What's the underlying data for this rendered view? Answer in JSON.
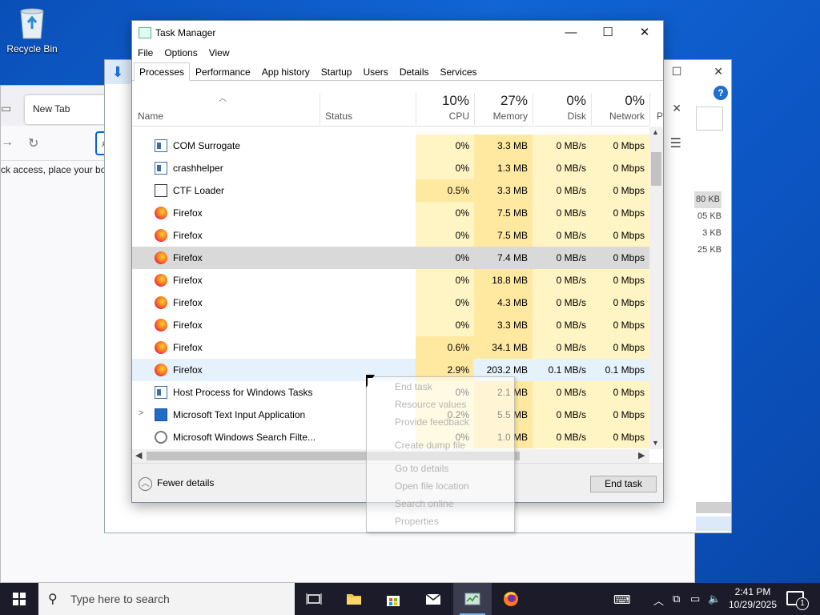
{
  "desktop": {
    "recycle_bin_label": "Recycle Bin"
  },
  "browser": {
    "tab_title": "New Tab",
    "bookmarks_hint": "ck access, place your bookmarks"
  },
  "explorer_bg": {
    "sizes": [
      "80 KB",
      "05 KB",
      "3 KB",
      "25 KB"
    ]
  },
  "task_manager": {
    "title": "Task Manager",
    "menu": [
      "File",
      "Options",
      "View"
    ],
    "tabs": [
      "Processes",
      "Performance",
      "App history",
      "Startup",
      "Users",
      "Details",
      "Services"
    ],
    "active_tab": "Processes",
    "columns": {
      "name": "Name",
      "status": "Status",
      "cpu": {
        "pct": "10%",
        "label": "CPU"
      },
      "memory": {
        "pct": "27%",
        "label": "Memory"
      },
      "disk": {
        "pct": "0%",
        "label": "Disk"
      },
      "network": {
        "pct": "0%",
        "label": "Network"
      },
      "power_cut": "P"
    },
    "rows": [
      {
        "name": "COM Surrogate",
        "cpu": "0%",
        "mem": "3.3 MB",
        "disk": "0 MB/s",
        "net": "0 Mbps",
        "icon": "window-icon"
      },
      {
        "name": "crashhelper",
        "cpu": "0%",
        "mem": "1.3 MB",
        "disk": "0 MB/s",
        "net": "0 Mbps",
        "icon": "window-icon"
      },
      {
        "name": "CTF Loader",
        "cpu": "0.5%",
        "mem": "3.3 MB",
        "disk": "0 MB/s",
        "net": "0 Mbps",
        "icon": "ctf-loader-icon"
      },
      {
        "name": "Firefox",
        "cpu": "0%",
        "mem": "7.5 MB",
        "disk": "0 MB/s",
        "net": "0 Mbps",
        "icon": "firefox-icon"
      },
      {
        "name": "Firefox",
        "cpu": "0%",
        "mem": "7.5 MB",
        "disk": "0 MB/s",
        "net": "0 Mbps",
        "icon": "firefox-icon"
      },
      {
        "name": "Firefox",
        "cpu": "0%",
        "mem": "7.4 MB",
        "disk": "0 MB/s",
        "net": "0 Mbps",
        "icon": "firefox-icon"
      },
      {
        "name": "Firefox",
        "cpu": "0%",
        "mem": "18.8 MB",
        "disk": "0 MB/s",
        "net": "0 Mbps",
        "icon": "firefox-icon"
      },
      {
        "name": "Firefox",
        "cpu": "0%",
        "mem": "4.3 MB",
        "disk": "0 MB/s",
        "net": "0 Mbps",
        "icon": "firefox-icon"
      },
      {
        "name": "Firefox",
        "cpu": "0%",
        "mem": "3.3 MB",
        "disk": "0 MB/s",
        "net": "0 Mbps",
        "icon": "firefox-icon"
      },
      {
        "name": "Firefox",
        "cpu": "0.6%",
        "mem": "34.1 MB",
        "disk": "0 MB/s",
        "net": "0 Mbps",
        "icon": "firefox-icon"
      },
      {
        "name": "Firefox",
        "cpu": "2.9%",
        "mem": "203.2 MB",
        "disk": "0.1 MB/s",
        "net": "0.1 Mbps",
        "icon": "firefox-icon"
      },
      {
        "name": "Host Process for Windows Tasks",
        "cpu": "0%",
        "mem": "2.1 MB",
        "disk": "0 MB/s",
        "net": "0 Mbps",
        "icon": "window-icon"
      },
      {
        "name": "Microsoft Text Input Application",
        "cpu": "0.2%",
        "mem": "5.5 MB",
        "disk": "0 MB/s",
        "net": "0 Mbps",
        "icon": "text-input-icon"
      },
      {
        "name": "Microsoft Windows Search Filte...",
        "cpu": "0%",
        "mem": "1.0 MB",
        "disk": "0 MB/s",
        "net": "0 Mbps",
        "icon": "search-filter-icon"
      }
    ],
    "fewer_details": "Fewer details",
    "end_task": "End task"
  },
  "context_menu": {
    "items": [
      "End task",
      "Resource values",
      "Provide feedback",
      "Create dump file",
      "Go to details",
      "Open file location",
      "Search online",
      "Properties"
    ]
  },
  "taskbar": {
    "search_placeholder": "Type here to search",
    "time": "2:41 PM",
    "date": "10/29/2025",
    "notification_count": "1"
  }
}
